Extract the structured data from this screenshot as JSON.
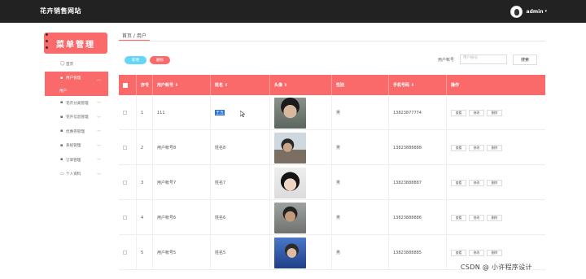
{
  "app": {
    "brand": "花卉销售网站",
    "username": "admin",
    "caret": "▾"
  },
  "sidebar": {
    "title": "菜单管理",
    "items": [
      {
        "label": "首页",
        "icon": "home-icon",
        "glyph": "◯",
        "chev": ""
      },
      {
        "label": "用户管理",
        "icon": "user-icon",
        "glyph": "▪",
        "chev": "︿",
        "active": true
      },
      {
        "label": "花卉分类管理",
        "icon": "bar-chart-icon",
        "glyph": "▪",
        "chev": "﹀"
      },
      {
        "label": "花卉信息管理",
        "icon": "grid-icon",
        "glyph": "▪",
        "chev": "﹀"
      },
      {
        "label": "优惠券管理",
        "icon": "trash-icon",
        "glyph": "▪",
        "chev": "﹀"
      },
      {
        "label": "系统管理",
        "icon": "grid-icon",
        "glyph": "▪",
        "chev": "﹀"
      },
      {
        "label": "订单管理",
        "icon": "grid-icon",
        "glyph": "▪",
        "chev": "﹀"
      },
      {
        "label": "个人资料",
        "icon": "id-card-icon",
        "glyph": "▭",
        "chev": "﹀"
      }
    ],
    "active_sub": "用户"
  },
  "breadcrumb": "首页 / 用户",
  "actions": {
    "add_label": "新增",
    "delete_label": "删除",
    "search_label": "用户帐号",
    "search_placeholder": "用户帐号",
    "search_button": "搜索"
  },
  "table": {
    "headers": [
      "",
      "序号",
      "用户帐号 ⇕",
      "姓名 ⇕",
      "头像 ⇕",
      "性别",
      "手机号码 ⇕",
      "操作"
    ],
    "op_labels": [
      "查看",
      "修改",
      "删除"
    ],
    "rows": [
      {
        "index": "1",
        "account": "111",
        "name": "王五",
        "gender": "男",
        "phone": "13823877774",
        "selected": true
      },
      {
        "index": "2",
        "account": "用户帐号8",
        "name": "姓名8",
        "gender": "男",
        "phone": "13823888888",
        "selected": false
      },
      {
        "index": "3",
        "account": "用户帐号7",
        "name": "姓名7",
        "gender": "男",
        "phone": "13823888887",
        "selected": false
      },
      {
        "index": "4",
        "account": "用户帐号6",
        "name": "姓名6",
        "gender": "男",
        "phone": "13823888886",
        "selected": false
      },
      {
        "index": "5",
        "account": "用户帐号5",
        "name": "姓名5",
        "gender": "男",
        "phone": "13823888885",
        "selected": false
      }
    ]
  },
  "watermark": "CSDN @ 小许程序设计",
  "colors": {
    "accent": "#fb6a6a",
    "topbar": "#222222",
    "add_button": "#65d6f8"
  }
}
